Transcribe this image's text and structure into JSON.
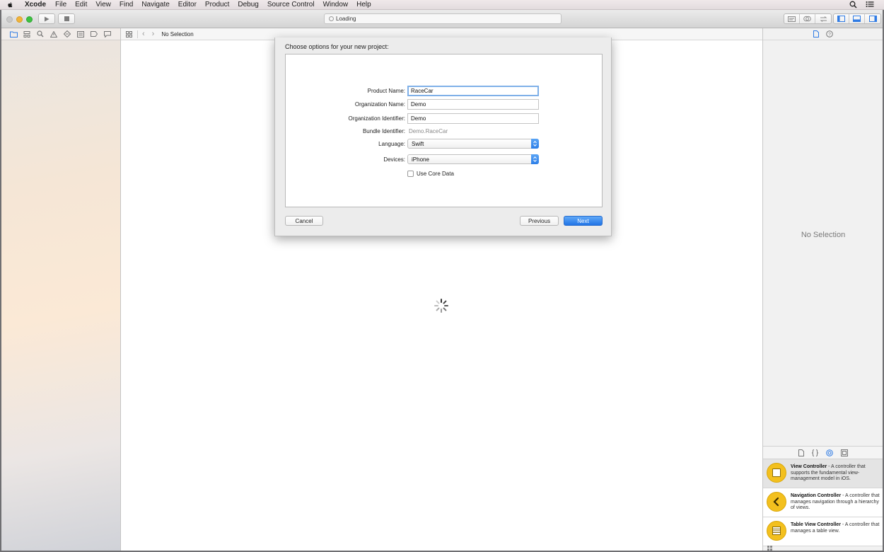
{
  "menubar": {
    "app_name": "Xcode",
    "items": [
      "File",
      "Edit",
      "View",
      "Find",
      "Navigate",
      "Editor",
      "Product",
      "Debug",
      "Source Control",
      "Window",
      "Help"
    ]
  },
  "toolbar": {
    "activity_text": "Loading"
  },
  "jumpbar": {
    "label": "No Selection"
  },
  "utilities": {
    "empty_label": "No Selection",
    "library": [
      {
        "title": "View Controller",
        "desc": " - A controller that supports the fundamental view-management model in iOS.",
        "icon": "view-controller-icon"
      },
      {
        "title": "Navigation Controller",
        "desc": " - A controller that manages navigation through a hierarchy of views.",
        "icon": "navigation-controller-icon"
      },
      {
        "title": "Table View Controller",
        "desc": " - A controller that manages a table view.",
        "icon": "table-view-controller-icon"
      }
    ]
  },
  "dialog": {
    "title": "Choose options for your new project:",
    "fields": {
      "product_name": {
        "label": "Product Name:",
        "value": "RaceCar"
      },
      "organization_name": {
        "label": "Organization Name:",
        "value": "Demo"
      },
      "organization_identifier": {
        "label": "Organization Identifier:",
        "value": "Demo"
      },
      "bundle_identifier": {
        "label": "Bundle Identifier:",
        "value": "Demo.RaceCar"
      },
      "language": {
        "label": "Language:",
        "value": "Swift"
      },
      "devices": {
        "label": "Devices:",
        "value": "iPhone"
      },
      "use_core_data": {
        "label": "Use Core Data",
        "checked": false
      }
    },
    "buttons": {
      "cancel": "Cancel",
      "previous": "Previous",
      "next": "Next"
    }
  },
  "colors": {
    "accent": "#2c7ee8",
    "library_icon": "#f3c01e"
  }
}
